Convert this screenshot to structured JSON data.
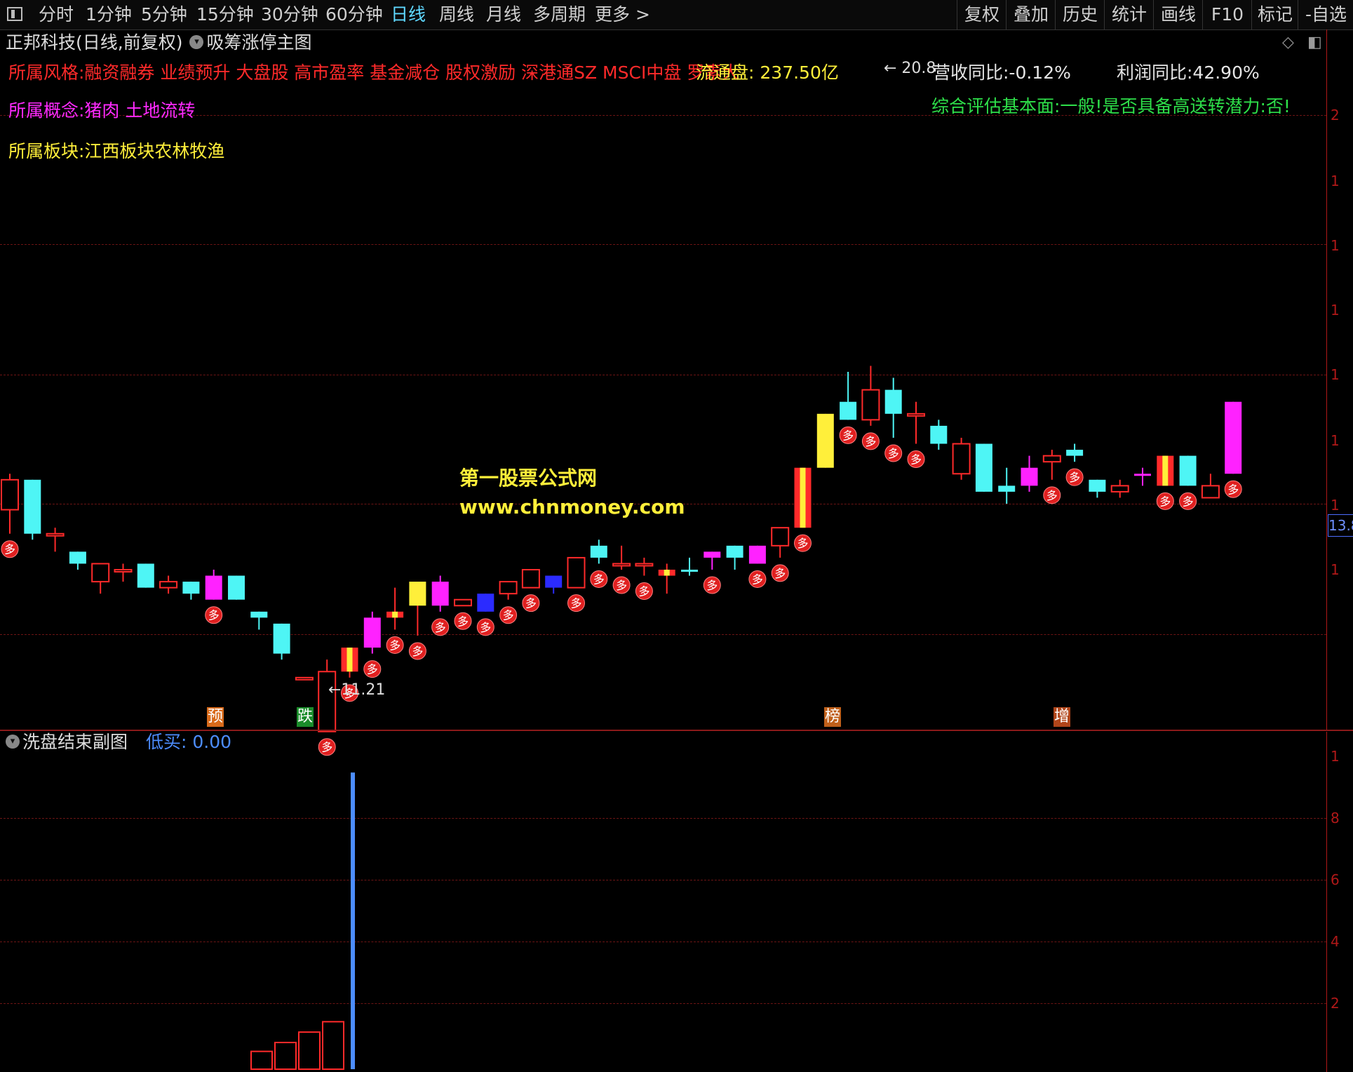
{
  "toolbar": {
    "periods": [
      "分时",
      "1分钟",
      "5分钟",
      "15分钟",
      "30分钟",
      "60分钟",
      "日线",
      "周线",
      "月线",
      "多周期",
      "更多 >"
    ],
    "active_period": "日线",
    "tools": [
      "复权",
      "叠加",
      "历史",
      "统计",
      "画线",
      "F10",
      "标记",
      "-自选"
    ]
  },
  "main_panel": {
    "stock_title": "正邦科技(日线,前复权)",
    "indicator_name": "吸筹涨停主图",
    "style_line": "所属风格:融资融券 业绩预升 大盘股 高市盈率 基金减仓 股权激励 深港通SZ MSCI中盘 罗素大",
    "concept_line": "所属概念:猪肉 土地流转",
    "sector_line": "所属板块:江西板块农林牧渔",
    "float_label": "流通盘:",
    "float_value": "237.50亿",
    "revenue_yoy": "营收同比:-0.12%",
    "profit_yoy": "利润同比:42.90%",
    "assessment": "综合评估基本面:一般!是否具备高送转潜力:否!",
    "high_marker": "20.8",
    "low_marker": "11.21",
    "price_box": "13.8",
    "watermark_title": "第一股票公式网",
    "watermark_url": "www.chnmoney.com",
    "bottom_tags": [
      {
        "text": "预",
        "color": "#d86a1a"
      },
      {
        "text": "跌",
        "color": "#1a8c2a"
      },
      {
        "text": "榜",
        "color": "#c0601a"
      },
      {
        "text": "增",
        "color": "#b0451a"
      }
    ],
    "axis_labels": [
      "2",
      "1",
      "1",
      "1",
      "1",
      "1",
      "1",
      "1"
    ]
  },
  "sub_panel": {
    "title": "洗盘结束副图",
    "value_label": "低买: 0.00",
    "axis_labels": [
      "1",
      "8",
      "6",
      "4",
      "2"
    ]
  },
  "chart_data": {
    "type": "candlestick",
    "price_range": [
      10.5,
      21.5
    ],
    "candles": [
      {
        "o": 13.7,
        "h": 14.3,
        "l": 13.3,
        "c": 14.2,
        "type": "hollow"
      },
      {
        "o": 14.2,
        "h": 14.2,
        "l": 13.2,
        "c": 13.3,
        "type": "cyan"
      },
      {
        "o": 13.3,
        "h": 13.4,
        "l": 13.0,
        "c": 13.3,
        "type": "cross"
      },
      {
        "o": 13.0,
        "h": 13.0,
        "l": 12.7,
        "c": 12.8,
        "type": "cyan"
      },
      {
        "o": 12.8,
        "h": 12.8,
        "l": 12.3,
        "c": 12.5,
        "type": "hollow"
      },
      {
        "o": 12.7,
        "h": 12.8,
        "l": 12.5,
        "c": 12.7,
        "type": "cross"
      },
      {
        "o": 12.8,
        "h": 12.8,
        "l": 12.4,
        "c": 12.4,
        "type": "cyan"
      },
      {
        "o": 12.5,
        "h": 12.6,
        "l": 12.3,
        "c": 12.4,
        "type": "cross"
      },
      {
        "o": 12.5,
        "h": 12.5,
        "l": 12.2,
        "c": 12.3,
        "type": "cyan"
      },
      {
        "o": 12.2,
        "h": 12.7,
        "l": 12.2,
        "c": 12.6,
        "type": "magenta"
      },
      {
        "o": 12.6,
        "h": 12.6,
        "l": 12.2,
        "c": 12.2,
        "type": "cyan"
      },
      {
        "o": 12.0,
        "h": 12.0,
        "l": 11.7,
        "c": 11.9,
        "type": "cyan"
      },
      {
        "o": 11.8,
        "h": 11.8,
        "l": 11.2,
        "c": 11.3,
        "type": "cyan"
      },
      {
        "o": 10.9,
        "h": 10.9,
        "l": 10.9,
        "c": 10.9,
        "type": "cross"
      },
      {
        "o": 10.0,
        "h": 11.2,
        "l": 10.0,
        "c": 11.0,
        "type": "hollow"
      },
      {
        "o": 11.0,
        "h": 11.4,
        "l": 10.9,
        "c": 11.4,
        "type": "limit"
      },
      {
        "o": 11.4,
        "h": 12.0,
        "l": 11.3,
        "c": 11.9,
        "type": "magenta"
      },
      {
        "o": 11.9,
        "h": 12.4,
        "l": 11.7,
        "c": 12.0,
        "type": "limit"
      },
      {
        "o": 12.1,
        "h": 12.4,
        "l": 11.6,
        "c": 12.5,
        "type": "yellow"
      },
      {
        "o": 12.1,
        "h": 12.6,
        "l": 12.0,
        "c": 12.5,
        "type": "magenta"
      },
      {
        "o": 12.1,
        "h": 12.2,
        "l": 12.1,
        "c": 12.2,
        "type": "hollow"
      },
      {
        "o": 12.0,
        "h": 12.3,
        "l": 12.0,
        "c": 12.3,
        "type": "blue"
      },
      {
        "o": 12.3,
        "h": 12.5,
        "l": 12.2,
        "c": 12.5,
        "type": "hollow"
      },
      {
        "o": 12.4,
        "h": 12.7,
        "l": 12.4,
        "c": 12.7,
        "type": "hollow"
      },
      {
        "o": 12.4,
        "h": 12.6,
        "l": 12.3,
        "c": 12.6,
        "type": "blue"
      },
      {
        "o": 12.4,
        "h": 12.9,
        "l": 12.4,
        "c": 12.9,
        "type": "hollow"
      },
      {
        "o": 13.1,
        "h": 13.2,
        "l": 12.8,
        "c": 12.9,
        "type": "cyan"
      },
      {
        "o": 12.8,
        "h": 13.1,
        "l": 12.7,
        "c": 12.8,
        "type": "cross"
      },
      {
        "o": 12.8,
        "h": 12.9,
        "l": 12.6,
        "c": 12.8,
        "type": "cross"
      },
      {
        "o": 12.6,
        "h": 12.8,
        "l": 12.3,
        "c": 12.7,
        "type": "limit"
      },
      {
        "o": 12.7,
        "h": 12.9,
        "l": 12.6,
        "c": 12.7,
        "type": "cyan"
      },
      {
        "o": 12.9,
        "h": 13.0,
        "l": 12.7,
        "c": 13.0,
        "type": "magenta"
      },
      {
        "o": 13.1,
        "h": 13.1,
        "l": 12.7,
        "c": 12.9,
        "type": "cyan"
      },
      {
        "o": 12.8,
        "h": 13.1,
        "l": 12.8,
        "c": 13.1,
        "type": "magenta"
      },
      {
        "o": 13.1,
        "h": 13.4,
        "l": 12.9,
        "c": 13.4,
        "type": "hollow"
      },
      {
        "o": 13.4,
        "h": 14.4,
        "l": 13.4,
        "c": 14.4,
        "type": "limit"
      },
      {
        "o": 14.4,
        "h": 15.3,
        "l": 14.4,
        "c": 15.3,
        "type": "yellow"
      },
      {
        "o": 15.2,
        "h": 16.0,
        "l": 15.2,
        "c": 15.5,
        "type": "cyan"
      },
      {
        "o": 15.2,
        "h": 16.1,
        "l": 15.1,
        "c": 15.7,
        "type": "hollow"
      },
      {
        "o": 15.7,
        "h": 15.9,
        "l": 14.9,
        "c": 15.3,
        "type": "cyan"
      },
      {
        "o": 15.3,
        "h": 15.5,
        "l": 14.8,
        "c": 15.3,
        "type": "cross"
      },
      {
        "o": 15.1,
        "h": 15.2,
        "l": 14.7,
        "c": 14.8,
        "type": "cyan"
      },
      {
        "o": 14.3,
        "h": 14.9,
        "l": 14.2,
        "c": 14.8,
        "type": "hollow"
      },
      {
        "o": 14.8,
        "h": 14.8,
        "l": 14.0,
        "c": 14.0,
        "type": "cyan"
      },
      {
        "o": 14.0,
        "h": 14.4,
        "l": 13.8,
        "c": 14.1,
        "type": "cyan"
      },
      {
        "o": 14.1,
        "h": 14.6,
        "l": 14.0,
        "c": 14.4,
        "type": "magenta"
      },
      {
        "o": 14.5,
        "h": 14.7,
        "l": 14.2,
        "c": 14.6,
        "type": "hollow"
      },
      {
        "o": 14.7,
        "h": 14.8,
        "l": 14.5,
        "c": 14.6,
        "type": "cyan"
      },
      {
        "o": 14.0,
        "h": 14.2,
        "l": 13.9,
        "c": 14.2,
        "type": "cyan"
      },
      {
        "o": 14.0,
        "h": 14.2,
        "l": 13.9,
        "c": 14.1,
        "type": "hollow"
      },
      {
        "o": 14.3,
        "h": 14.4,
        "l": 14.1,
        "c": 14.3,
        "type": "magenta"
      },
      {
        "o": 14.1,
        "h": 14.6,
        "l": 14.1,
        "c": 14.6,
        "type": "limit"
      },
      {
        "o": 14.6,
        "h": 14.6,
        "l": 14.1,
        "c": 14.1,
        "type": "cyan"
      },
      {
        "o": 13.9,
        "h": 14.3,
        "l": 13.9,
        "c": 14.1,
        "type": "hollow"
      },
      {
        "o": 14.3,
        "h": 15.5,
        "l": 14.3,
        "c": 15.5,
        "type": "magenta"
      }
    ],
    "sub_bars": [
      {
        "index": 11,
        "value": 0.6,
        "type": "outline"
      },
      {
        "index": 12,
        "value": 0.9,
        "type": "outline"
      },
      {
        "index": 13,
        "value": 1.25,
        "type": "outline"
      },
      {
        "index": 14,
        "value": 1.6,
        "type": "outline"
      },
      {
        "index": 15,
        "value": 10.0,
        "type": "signal"
      }
    ],
    "sub_range": [
      0,
      10.5
    ]
  }
}
